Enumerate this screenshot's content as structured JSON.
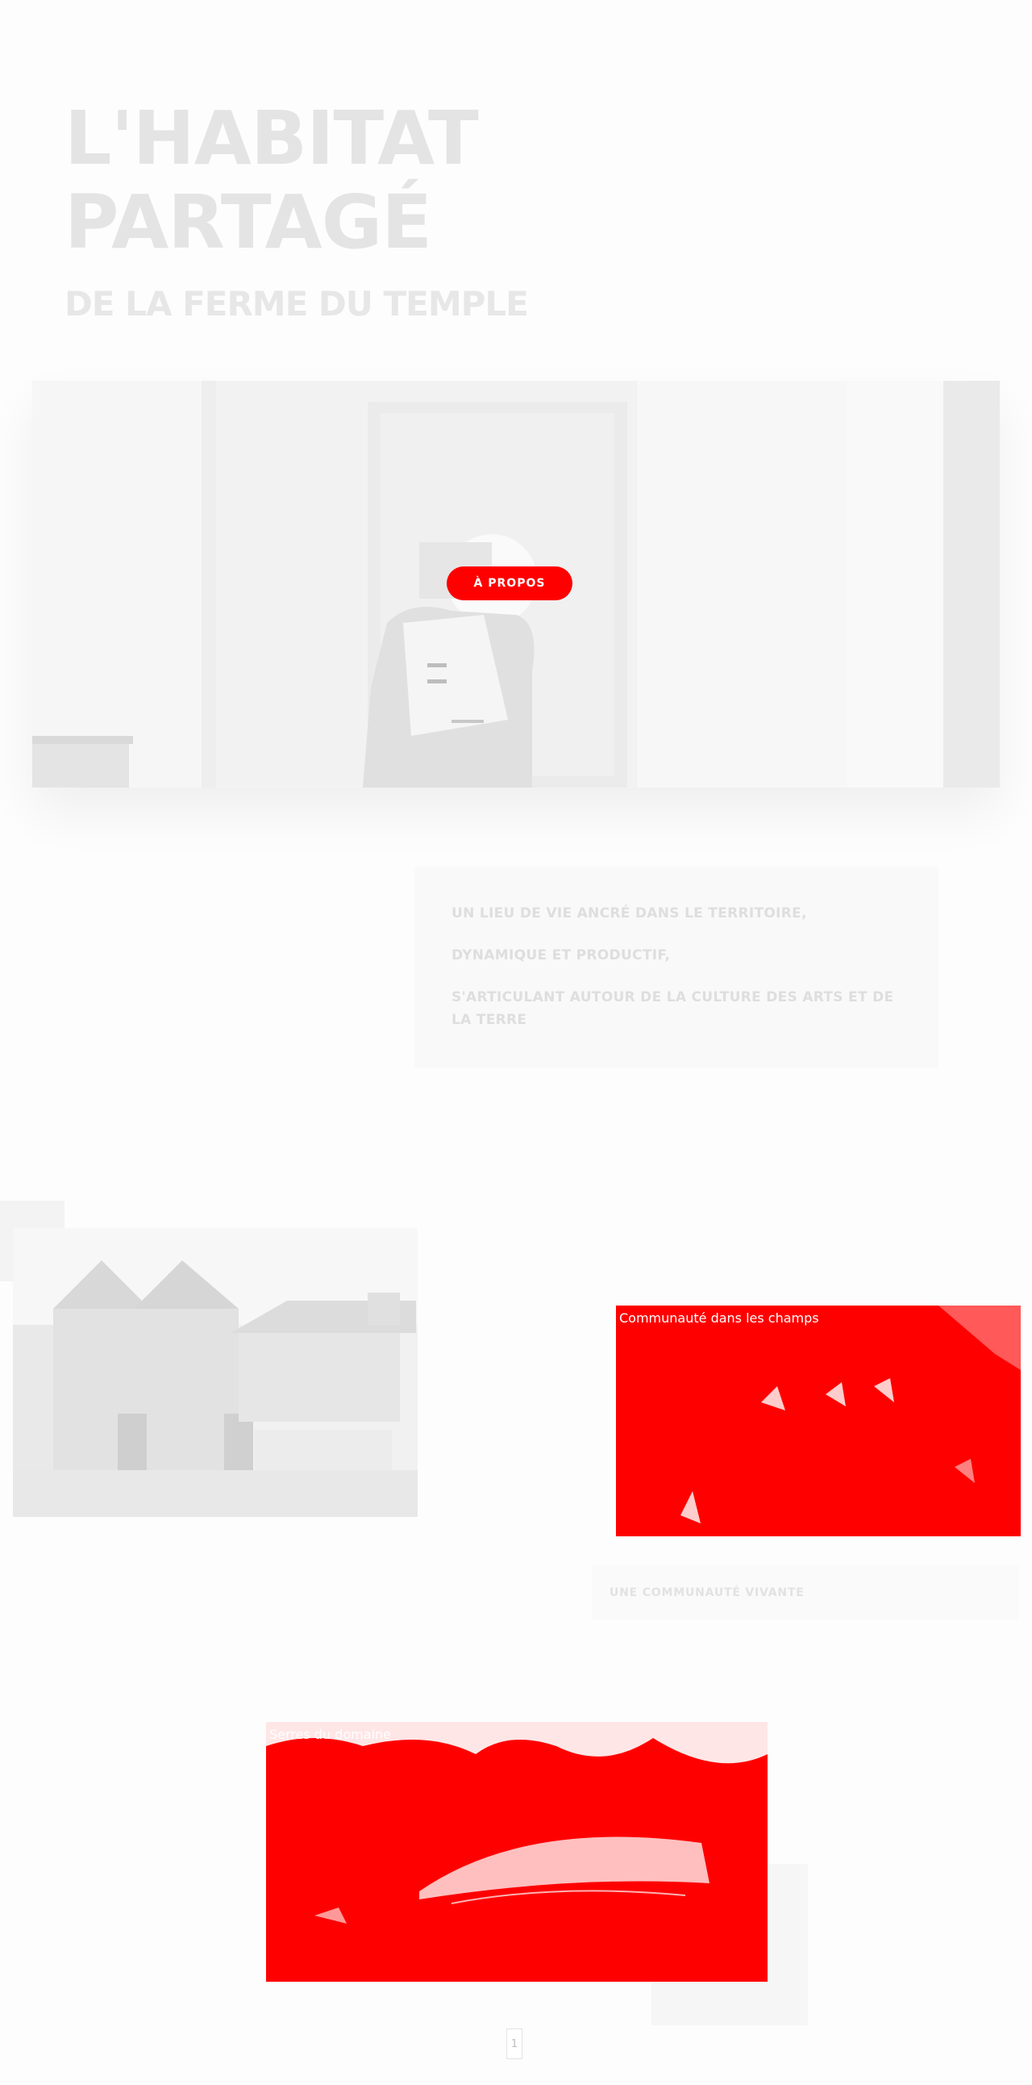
{
  "header": {
    "title_line1": "L'HABITAT",
    "title_line2": "PARTAGÉ",
    "subtitle": "DE LA FERME DU TEMPLE"
  },
  "hero": {
    "badge_label": "À PROPOS"
  },
  "intro": {
    "lines": [
      "UN LIEU DE VIE ANCRÉ DANS LE TERRITOIRE,",
      "DYNAMIQUE ET PRODUCTIF,",
      "S'ARTICULANT AUTOUR DE LA CULTURE DES ARTS ET DE LA TERRE"
    ]
  },
  "gallery": {
    "community_caption": "Communauté dans les champs",
    "community_label": "UNE COMMUNAUTÉ VIVANTE",
    "greenhouse_caption": "Serres du domaine"
  },
  "pagination": {
    "current": "1"
  },
  "colors": {
    "accent": "#ff0000",
    "heading": "#e4e4e4",
    "background": "#fdfdfd"
  }
}
